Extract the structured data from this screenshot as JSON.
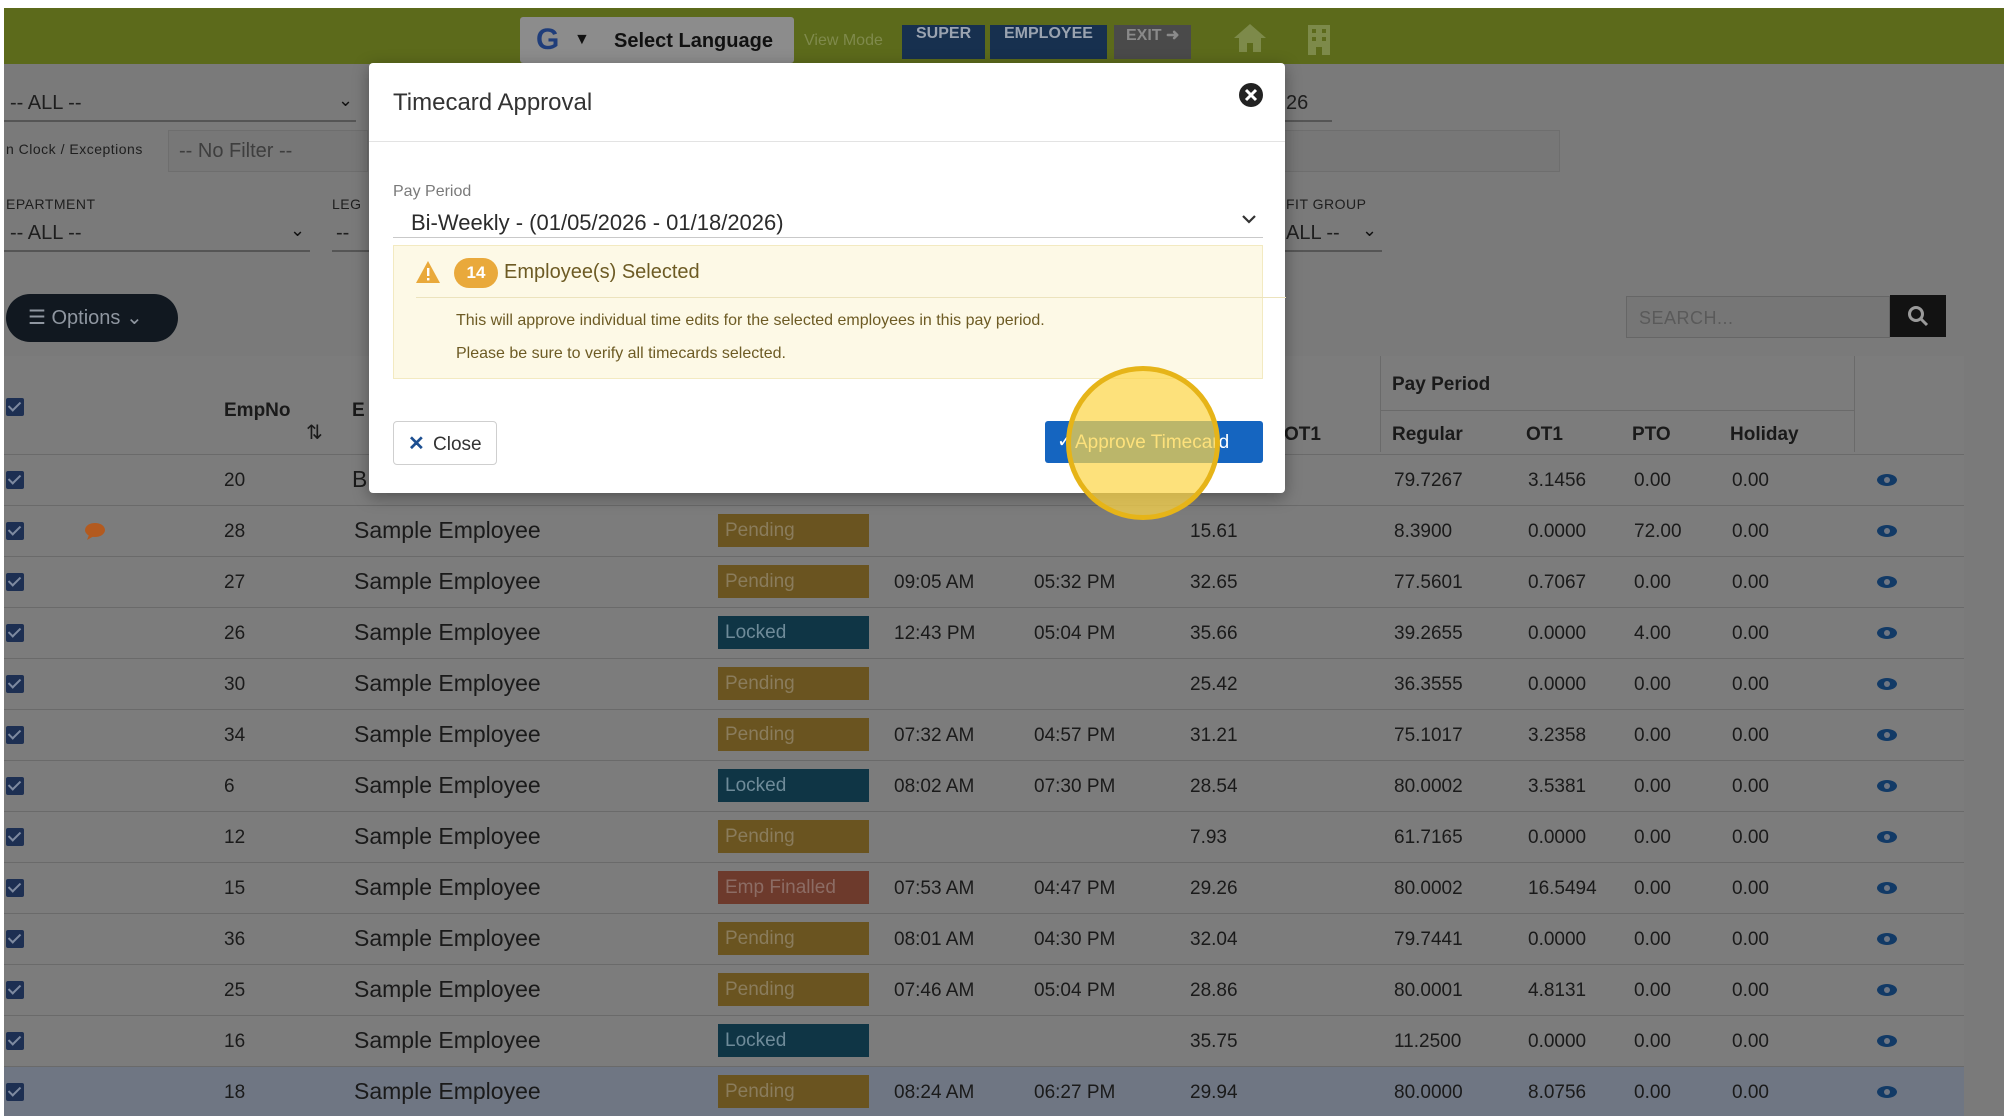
{
  "topbar": {
    "language_label": "Select Language",
    "view_mode_label": "View Mode",
    "super_label": "SUPER",
    "employee_label": "EMPLOYEE",
    "exit_label": "EXIT",
    "bg_color": "#8db33a"
  },
  "filters": {
    "clock_setup_value": "-- ALL --",
    "exceptions_label": "n Clock / Exceptions",
    "exceptions_placeholder": "-- No Filter --",
    "department_label": "EPARTMENT",
    "department_value": "-- ALL --",
    "legal_label": "LEG",
    "legal_value": "--",
    "date_partial": "26",
    "benefit_group_label": "FIT GROUP",
    "benefit_group_value": "ALL --"
  },
  "toolbar": {
    "options_label": "Options",
    "search_placeholder": "SEARCH..."
  },
  "table": {
    "headers": {
      "empno": "EmpNo",
      "emp_partial": "E",
      "ot1_left": "OT1",
      "pay_period_group": "Pay Period",
      "regular": "Regular",
      "ot1": "OT1",
      "pto": "PTO",
      "holiday": "Holiday"
    },
    "rows": [
      {
        "empno": "20",
        "name": "B",
        "status": "",
        "status_type": "pending",
        "in": "",
        "out": "",
        "hours": "",
        "regular": "79.7267",
        "ot1": "3.1456",
        "pto": "0.00",
        "holiday": "0.00",
        "has_comment": false
      },
      {
        "empno": "28",
        "name": "Sample Employee",
        "status": "Pending",
        "status_type": "pending",
        "in": "",
        "out": "",
        "hours": "15.61",
        "regular": "8.3900",
        "ot1": "0.0000",
        "pto": "72.00",
        "holiday": "0.00",
        "has_comment": true
      },
      {
        "empno": "27",
        "name": "Sample Employee",
        "status": "Pending",
        "status_type": "pending",
        "in": "09:05 AM",
        "out": "05:32 PM",
        "hours": "32.65",
        "regular": "77.5601",
        "ot1": "0.7067",
        "pto": "0.00",
        "holiday": "0.00",
        "has_comment": false
      },
      {
        "empno": "26",
        "name": "Sample Employee",
        "status": "Locked",
        "status_type": "locked",
        "in": "12:43 PM",
        "out": "05:04 PM",
        "hours": "35.66",
        "regular": "39.2655",
        "ot1": "0.0000",
        "pto": "4.00",
        "holiday": "0.00",
        "has_comment": false
      },
      {
        "empno": "30",
        "name": "Sample Employee",
        "status": "Pending",
        "status_type": "pending",
        "in": "",
        "out": "",
        "hours": "25.42",
        "regular": "36.3555",
        "ot1": "0.0000",
        "pto": "0.00",
        "holiday": "0.00",
        "has_comment": false
      },
      {
        "empno": "34",
        "name": "Sample Employee",
        "status": "Pending",
        "status_type": "pending",
        "in": "07:32 AM",
        "out": "04:57 PM",
        "hours": "31.21",
        "regular": "75.1017",
        "ot1": "3.2358",
        "pto": "0.00",
        "holiday": "0.00",
        "has_comment": false
      },
      {
        "empno": "6",
        "name": "Sample Employee",
        "status": "Locked",
        "status_type": "locked",
        "in": "08:02 AM",
        "out": "07:30 PM",
        "hours": "28.54",
        "regular": "80.0002",
        "ot1": "3.5381",
        "pto": "0.00",
        "holiday": "0.00",
        "has_comment": false
      },
      {
        "empno": "12",
        "name": "Sample Employee",
        "status": "Pending",
        "status_type": "pending",
        "in": "",
        "out": "",
        "hours": "7.93",
        "regular": "61.7165",
        "ot1": "0.0000",
        "pto": "0.00",
        "holiday": "0.00",
        "has_comment": false
      },
      {
        "empno": "15",
        "name": "Sample Employee",
        "status": "Emp Finalled",
        "status_type": "finalled",
        "in": "07:53 AM",
        "out": "04:47 PM",
        "hours": "29.26",
        "regular": "80.0002",
        "ot1": "16.5494",
        "pto": "0.00",
        "holiday": "0.00",
        "has_comment": false
      },
      {
        "empno": "36",
        "name": "Sample Employee",
        "status": "Pending",
        "status_type": "pending",
        "in": "08:01 AM",
        "out": "04:30 PM",
        "hours": "32.04",
        "regular": "79.7441",
        "ot1": "0.0000",
        "pto": "0.00",
        "holiday": "0.00",
        "has_comment": false
      },
      {
        "empno": "25",
        "name": "Sample Employee",
        "status": "Pending",
        "status_type": "pending",
        "in": "07:46 AM",
        "out": "05:04 PM",
        "hours": "28.86",
        "regular": "80.0001",
        "ot1": "4.8131",
        "pto": "0.00",
        "holiday": "0.00",
        "has_comment": false
      },
      {
        "empno": "16",
        "name": "Sample Employee",
        "status": "Locked",
        "status_type": "locked",
        "in": "",
        "out": "",
        "hours": "35.75",
        "regular": "11.2500",
        "ot1": "0.0000",
        "pto": "0.00",
        "holiday": "0.00",
        "has_comment": false
      },
      {
        "empno": "18",
        "name": "Sample Employee",
        "status": "Pending",
        "status_type": "pending",
        "in": "08:24 AM",
        "out": "06:27 PM",
        "hours": "29.94",
        "regular": "80.0000",
        "ot1": "8.0756",
        "pto": "0.00",
        "holiday": "0.00",
        "has_comment": false
      }
    ]
  },
  "modal": {
    "title": "Timecard Approval",
    "pay_period_label": "Pay Period",
    "pay_period_value": "Bi-Weekly - (01/05/2026 - 01/18/2026)",
    "selected_count": "14",
    "selected_text": "Employee(s) Selected",
    "message_line1": "This will approve individual time edits for the selected employees in this pay period.",
    "message_line2": "Please be sure to verify all timecards selected.",
    "close_label": "Close",
    "approve_label": "Approve Timecard",
    "approve_color": "#1565c0"
  }
}
